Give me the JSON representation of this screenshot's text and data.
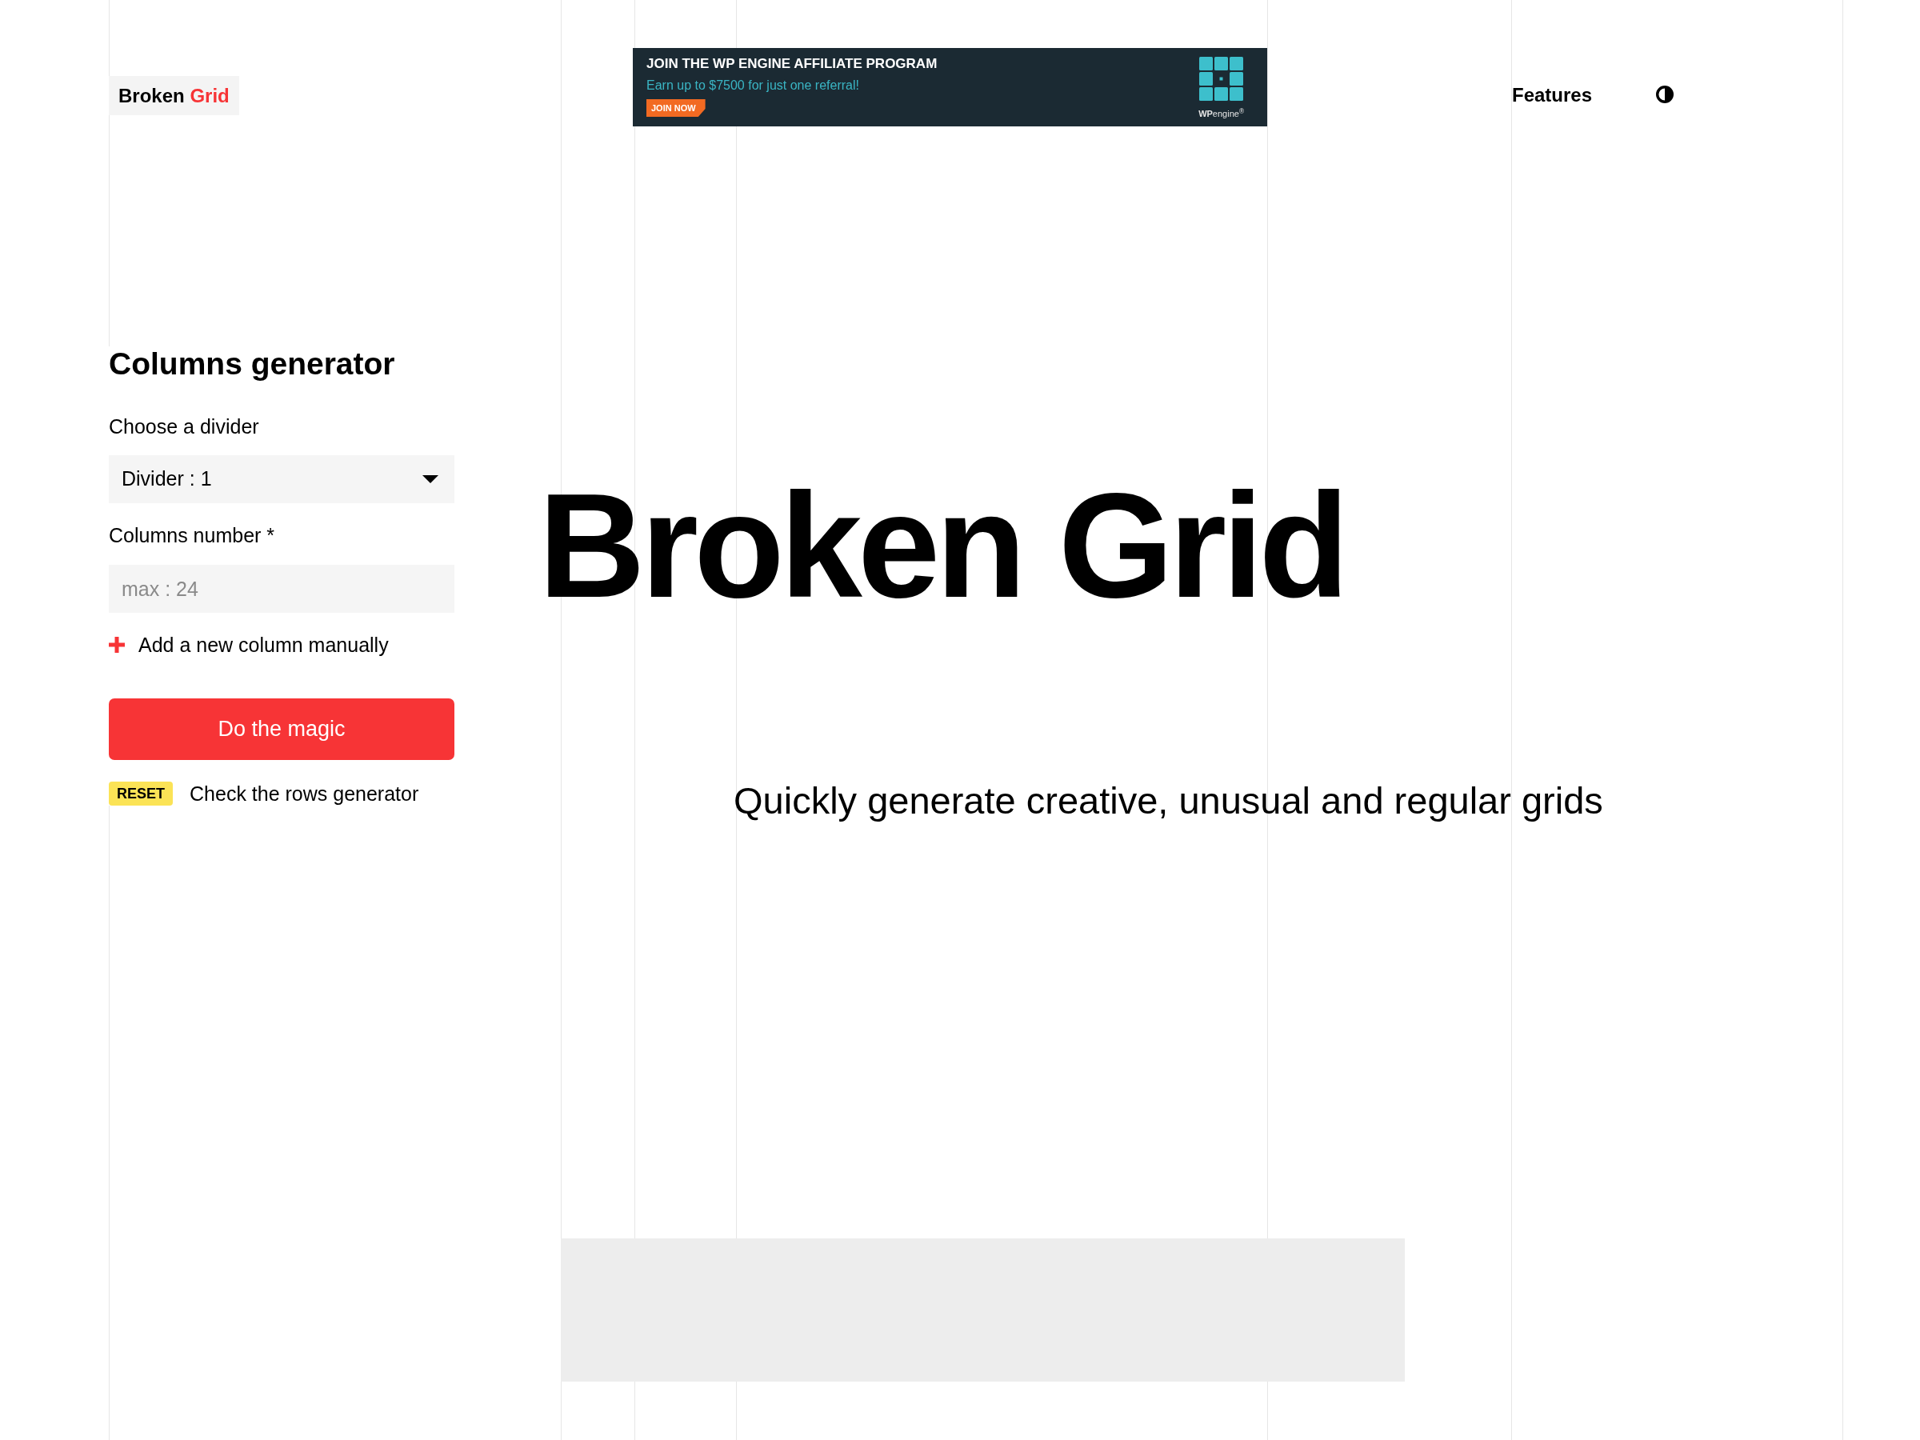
{
  "header": {
    "logo": {
      "text": "Broken",
      "accent": "Grid"
    },
    "ad": {
      "title": "JOIN THE WP ENGINE AFFILIATE PROGRAM",
      "subtitle": "Earn up to $7500 for just one referral!",
      "button": "JOIN NOW",
      "brand": "**WP**engine$^{®}$"
    },
    "nav": [
      {
        "label": "Features"
      }
    ]
  },
  "generator": {
    "title": "Columns generator",
    "divider_label": "Choose a divider",
    "divider_select": {
      "value": "Divider : 1"
    },
    "columns_label": "Columns number *",
    "columns_input": {
      "placeholder": "max : 24"
    },
    "add_column": "Add a new column manually",
    "submit": "Do the magic",
    "reset": "RESET",
    "rows_link": "Check the rows generator"
  },
  "hero": {
    "title": "Broken Grid",
    "subtitle": "Quickly generate creative, unusual and regular grids"
  }
}
